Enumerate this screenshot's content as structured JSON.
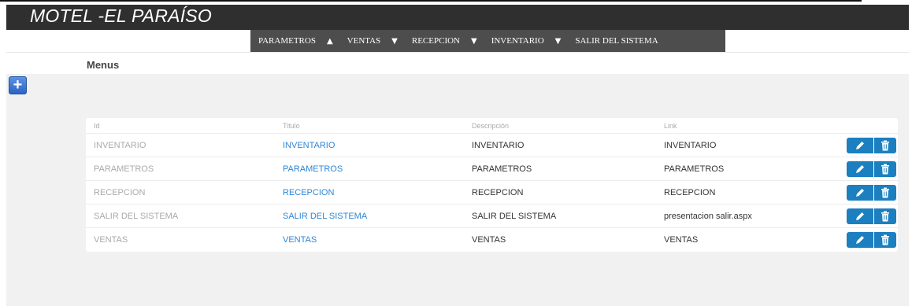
{
  "app": {
    "title": "MOTEL -EL PARAÍSO"
  },
  "nav": {
    "items": [
      {
        "label": "PARAMETROS",
        "arrow": "▲"
      },
      {
        "label": "VENTAS",
        "arrow": "▼"
      },
      {
        "label": "RECEPCION",
        "arrow": "▼"
      },
      {
        "label": "INVENTARIO",
        "arrow": "▼"
      },
      {
        "label": "SALIR DEL SISTEMA",
        "arrow": ""
      }
    ]
  },
  "page": {
    "title": "Menus",
    "add_icon": "plus-icon"
  },
  "table": {
    "headers": {
      "id": "Id",
      "titulo": "Titulo",
      "descripcion": "Descripción",
      "link": "Link"
    },
    "rows": [
      {
        "id": "INVENTARIO",
        "titulo": "INVENTARIO",
        "descripcion": "INVENTARIO",
        "link": "INVENTARIO"
      },
      {
        "id": "PARAMETROS",
        "titulo": "PARAMETROS",
        "descripcion": "PARAMETROS",
        "link": "PARAMETROS"
      },
      {
        "id": "RECEPCION",
        "titulo": "RECEPCION",
        "descripcion": "RECEPCION",
        "link": "RECEPCION"
      },
      {
        "id": "SALIR DEL SISTEMA",
        "titulo": "SALIR DEL SISTEMA",
        "descripcion": "SALIR DEL SISTEMA",
        "link": "presentacion salir.aspx"
      },
      {
        "id": "VENTAS",
        "titulo": "VENTAS",
        "descripcion": "VENTAS",
        "link": "VENTAS"
      }
    ]
  },
  "colors": {
    "header_bg": "#2f2f2f",
    "nav_bg": "#4d4d4d",
    "action_blue": "#1b7fc0",
    "link_blue": "#2e86d6"
  }
}
